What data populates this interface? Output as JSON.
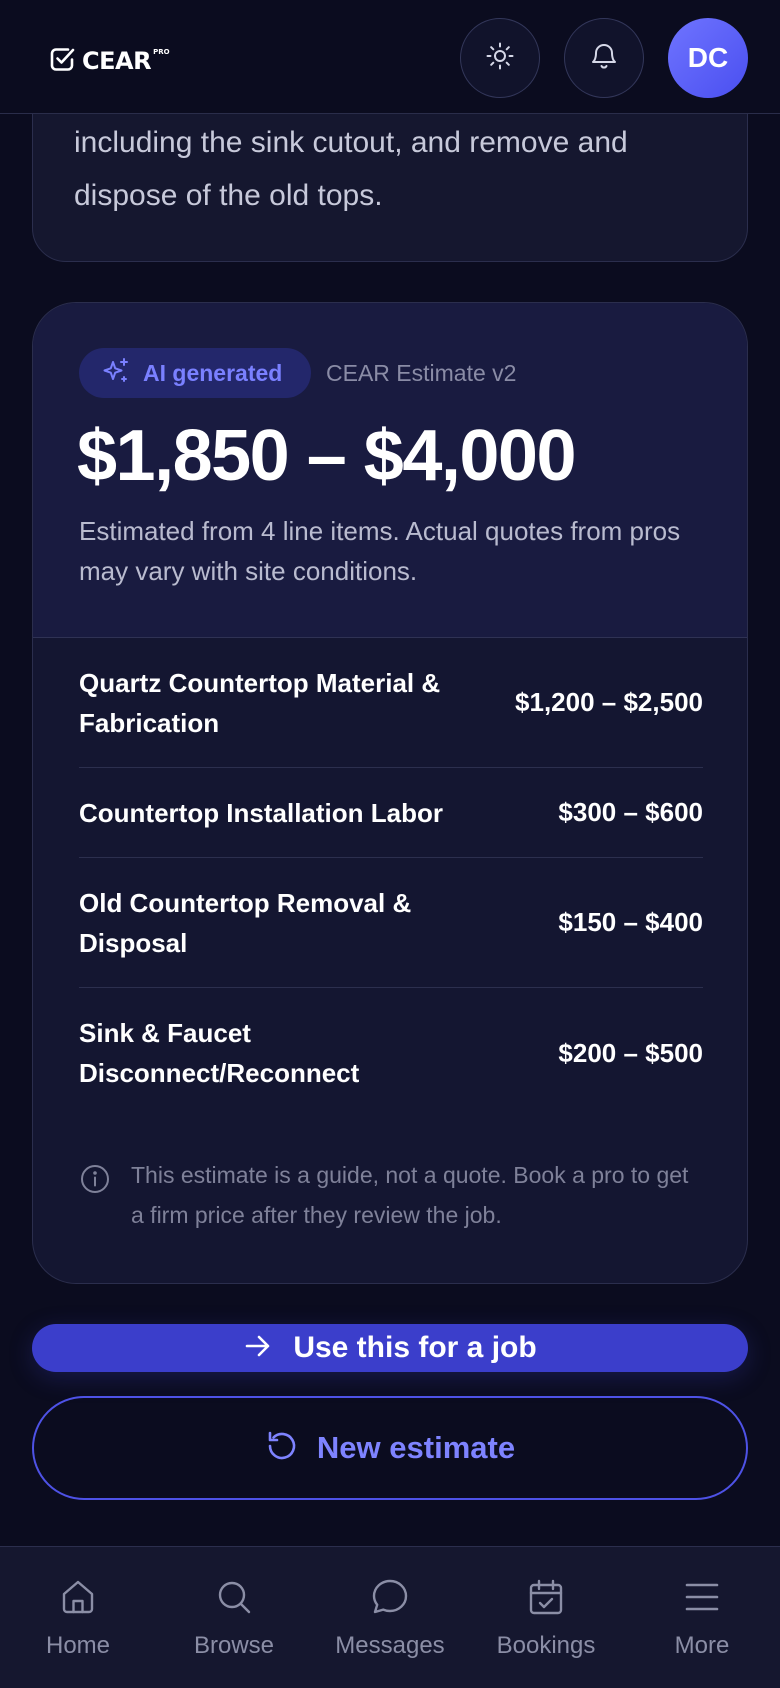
{
  "header": {
    "logo_text": "CEAR",
    "logo_badge": "PRO",
    "avatar_initials": "DC"
  },
  "description": {
    "text": "including the sink cutout, and remove and dispose of the old tops."
  },
  "estimate": {
    "badge_label": "AI generated",
    "version": "CEAR Estimate v2",
    "price_range": "$1,850 – $4,000",
    "note": "Estimated from 4 line items. Actual quotes from pros may vary with site conditions.",
    "line_items": [
      {
        "name": "Quartz Countertop Material & Fabrication",
        "price": "$1,200 – $2,500"
      },
      {
        "name": "Countertop Installation Labor",
        "price": "$300 – $600"
      },
      {
        "name": "Old Countertop Removal & Disposal",
        "price": "$150 – $400"
      },
      {
        "name": "Sink & Faucet Disconnect/Reconnect",
        "price": "$200 – $500"
      }
    ],
    "disclaimer": "This estimate is a guide, not a quote. Book a pro to get a firm price after they review the job."
  },
  "actions": {
    "primary_label": "Use this for a job",
    "secondary_label": "New estimate"
  },
  "nav": {
    "items": [
      {
        "label": "Home",
        "icon": "home-icon"
      },
      {
        "label": "Browse",
        "icon": "search-icon"
      },
      {
        "label": "Messages",
        "icon": "chat-bubble-icon"
      },
      {
        "label": "Bookings",
        "icon": "calendar-check-icon"
      },
      {
        "label": "More",
        "icon": "menu-icon"
      }
    ]
  },
  "colors": {
    "background": "#0b0c1f",
    "card": "#141631",
    "accent": "#3b3ecb",
    "accent_text": "#7e83ff"
  }
}
